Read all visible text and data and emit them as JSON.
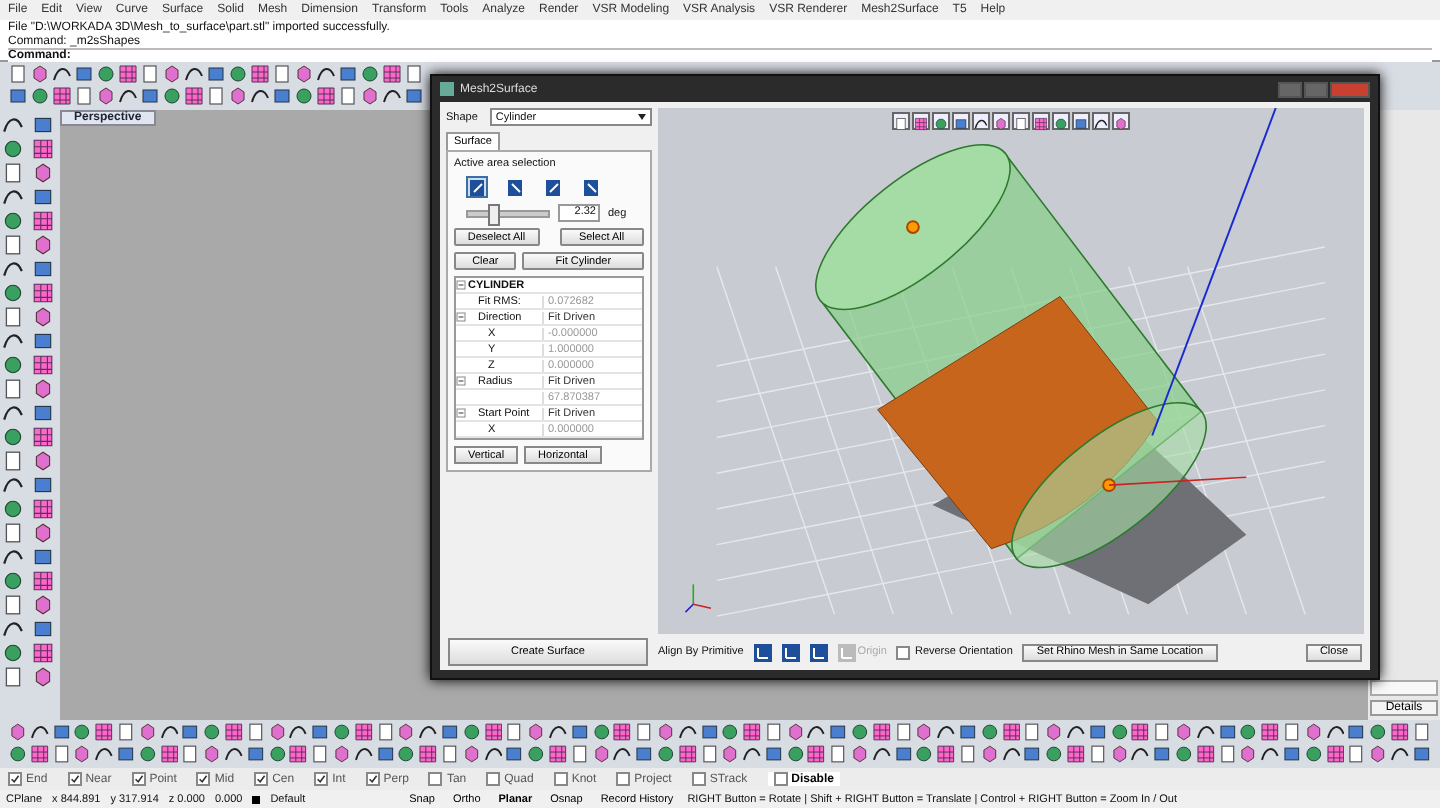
{
  "menu": [
    "File",
    "Edit",
    "View",
    "Curve",
    "Surface",
    "Solid",
    "Mesh",
    "Dimension",
    "Transform",
    "Tools",
    "Analyze",
    "Render",
    "VSR Modeling",
    "VSR Analysis",
    "VSR Renderer",
    "Mesh2Surface",
    "T5",
    "Help"
  ],
  "command_history": [
    "File \"D:\\WORKADA 3D\\Mesh_to_surface\\part.stl\" imported successfully.",
    "Command: _m2sShapes"
  ],
  "command_prompt": "Command:",
  "viewport_tab": "Perspective",
  "dialog": {
    "title": "Mesh2Surface",
    "shape_label": "Shape",
    "shape_value": "Cylinder",
    "tabs": [
      {
        "label": "Surface",
        "selected": true
      }
    ],
    "area_label": "Active area selection",
    "area_tools": [
      {
        "selected": true
      },
      {
        "selected": false
      },
      {
        "selected": false
      },
      {
        "selected": false
      }
    ],
    "tolerance": {
      "level": 0.3,
      "value": "2.32",
      "unit": "deg"
    },
    "buttons_row1": [
      "Deselect All",
      "Select All"
    ],
    "buttons_row2": [
      "Clear",
      "Fit Cylinder"
    ],
    "property_grid": [
      {
        "label": "CYLINDER",
        "expanded": true,
        "children": [
          {
            "label": "Fit RMS:",
            "value": "0.072682"
          },
          {
            "label": "Direction",
            "value": "Fit Driven",
            "expanded": true,
            "children": [
              {
                "label": "X",
                "value": "-0.000000"
              },
              {
                "label": "Y",
                "value": "1.000000"
              },
              {
                "label": "Z",
                "value": "0.000000"
              }
            ]
          },
          {
            "label": "Radius",
            "value": "Fit Driven",
            "expanded": true,
            "children": [
              {
                "value": "67.870387"
              }
            ]
          },
          {
            "label": "Start Point",
            "value": "Fit Driven",
            "expanded": true,
            "children": [
              {
                "label": "X",
                "value": "0.000000"
              }
            ]
          }
        ]
      }
    ],
    "view_buttons": [
      "Vertical",
      "Horizontal"
    ],
    "create_button": "Create Surface",
    "align_label": "Align By Primitive",
    "align_tools": [
      {
        "disabled": false
      },
      {
        "disabled": false
      },
      {
        "disabled": false
      },
      {
        "disabled": true,
        "label": "Origin"
      }
    ],
    "reverse_orientation": {
      "label": "Reverse Orientation",
      "checked": false
    },
    "set_location_button": "Set Rhino Mesh in Same Location",
    "close_button": "Close"
  },
  "side_panel": {
    "button": "Details"
  },
  "osnaps": [
    {
      "label": "End",
      "checked": true
    },
    {
      "label": "Near",
      "checked": true
    },
    {
      "label": "Point",
      "checked": true
    },
    {
      "label": "Mid",
      "checked": true
    },
    {
      "label": "Cen",
      "checked": true
    },
    {
      "label": "Int",
      "checked": true
    },
    {
      "label": "Perp",
      "checked": true
    },
    {
      "label": "Tan",
      "checked": false
    },
    {
      "label": "Quad",
      "checked": false
    },
    {
      "label": "Knot",
      "checked": false
    },
    {
      "label": "Project",
      "checked": false
    },
    {
      "label": "STrack",
      "checked": false
    }
  ],
  "osnap_disable": "Disable",
  "status_bar": {
    "cplane": "CPlane",
    "x": "x 844.891",
    "y": "y 317.914",
    "z": "z 0.000",
    "distance": "0.000",
    "layer": "Default",
    "toggles": [
      {
        "label": "Snap",
        "selected": false
      },
      {
        "label": "Ortho",
        "selected": false
      },
      {
        "label": "Planar",
        "selected": true
      },
      {
        "label": "Osnap",
        "selected": false
      },
      {
        "label": "Record History",
        "selected": false
      }
    ],
    "hint": "RIGHT Button = Rotate | Shift + RIGHT Button = Translate | Control + RIGHT Button = Zoom In / Out"
  }
}
